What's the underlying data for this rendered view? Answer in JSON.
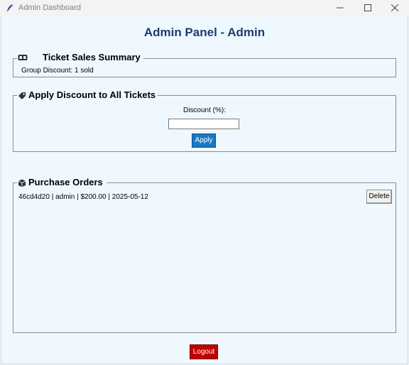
{
  "window": {
    "title": "Admin Dashboard",
    "app_icon": "feather-icon",
    "controls": [
      "minimize-icon",
      "maximize-icon",
      "close-icon"
    ]
  },
  "header": {
    "title": "Admin Panel - Admin",
    "color": "#1c3d6e"
  },
  "sales_summary": {
    "legend": "Ticket Sales Summary",
    "icon": "ticket-icon",
    "lines": [
      "Group Discount: 1 sold"
    ]
  },
  "discount": {
    "legend": "Apply Discount to All Tickets",
    "icon": "tag-icon",
    "field_label": "Discount (%):",
    "field_value": "",
    "apply_label": "Apply",
    "apply_color": "#1a78c2"
  },
  "orders": {
    "legend": "Purchase Orders",
    "icon": "package-icon",
    "items": [
      {
        "text": "46cd4d20 | admin | $200.00 | 2025-05-12",
        "delete_label": "Delete"
      }
    ]
  },
  "footer": {
    "logout_label": "Logout",
    "logout_color": "#c00000"
  }
}
